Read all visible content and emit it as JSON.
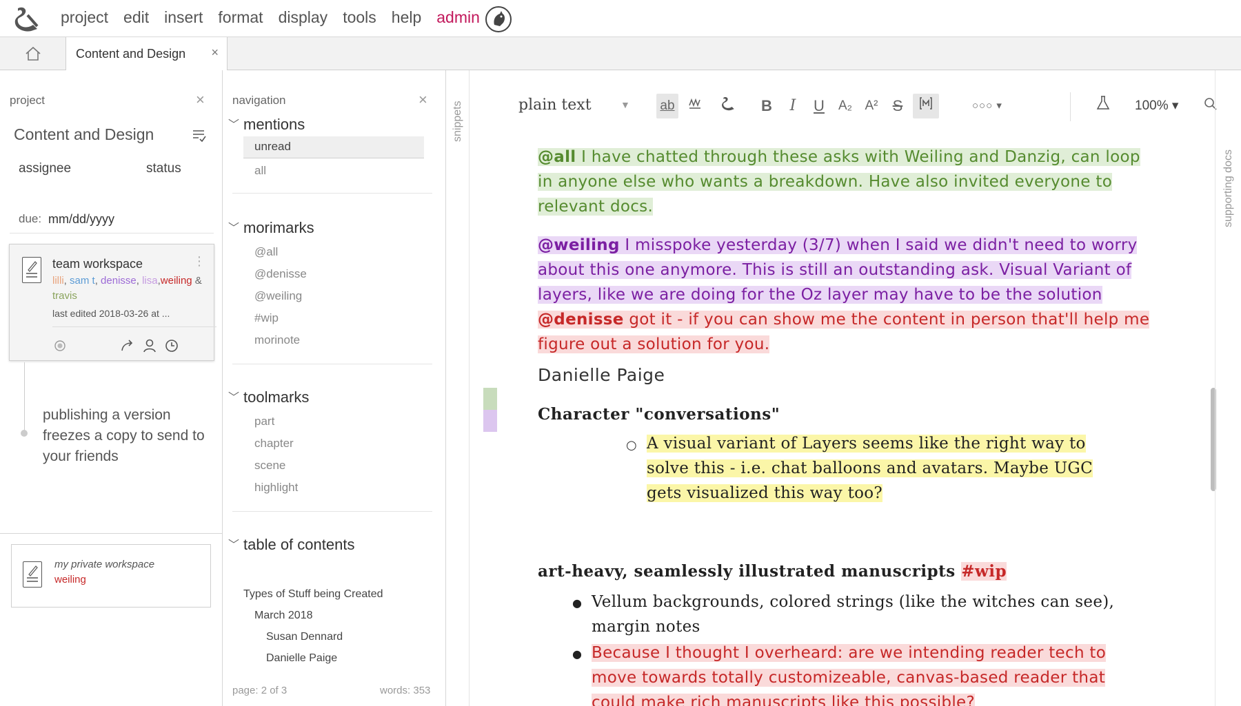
{
  "menu": {
    "items": [
      "project",
      "edit",
      "insert",
      "format",
      "display",
      "tools",
      "help"
    ],
    "admin": "admin"
  },
  "tabs": {
    "doc_tab": "Content and Design",
    "close": "×"
  },
  "project_panel": {
    "header": "project",
    "close": "×",
    "title": "Content and Design",
    "assignee_label": "assignee",
    "status_label": "status",
    "due_label": "due:",
    "due_value": "mm/dd/yyyy",
    "card": {
      "title": "team workspace",
      "members": [
        {
          "name": "lilli",
          "color": "#e8a37c",
          "sep": ", "
        },
        {
          "name": "sam t",
          "color": "#5b9bd5",
          "sep": ", "
        },
        {
          "name": "denisse",
          "color": "#9c6ad6",
          "sep": ", "
        },
        {
          "name": "lisa",
          "color": "#c59be0",
          "sep": ","
        },
        {
          "name": "weiling",
          "color": "#c62828",
          "sep": " & "
        },
        {
          "name": "travis",
          "color": "#8aa35c",
          "sep": ""
        }
      ],
      "edited": "last edited 2018-03-26 at ..."
    },
    "publish_note": "publishing a version freezes a copy to send to your friends",
    "private_card": {
      "title": "my private workspace",
      "user": "weiling"
    }
  },
  "navigation": {
    "header": "navigation",
    "close": "×",
    "mentions": {
      "label": "mentions",
      "items": [
        "unread",
        "all"
      ]
    },
    "morimarks": {
      "label": "morimarks",
      "items": [
        "@all",
        "@denisse",
        "@weiling",
        "#wip",
        "morinote"
      ]
    },
    "toolmarks": {
      "label": "toolmarks",
      "items": [
        "part",
        "chapter",
        "scene",
        "highlight"
      ]
    },
    "toc": {
      "label": "table of contents",
      "items": [
        "Types of Stuff being Created",
        "March 2018",
        "Susan Dennard",
        "Danielle Paige"
      ]
    },
    "page": "page: 2 of 3",
    "words": "words: 353"
  },
  "sidebar_labels": {
    "snippets": "snippets",
    "supporting_docs": "supporting docs"
  },
  "toolbar": {
    "style": "plain text",
    "ab": "ab",
    "bold": "B",
    "italic": "I",
    "underline": "U",
    "subscript": "A₂",
    "superscript": "A²",
    "strike": "S",
    "more": "○○○ ▾",
    "zoom": "100% ▾"
  },
  "editor": {
    "p1_mention": "@all",
    "p1_text": " I have chatted through these asks with Weiling and Danzig, can loop in anyone else who wants a breakdown. Have also invited everyone to relevant docs.",
    "p2_mention": "@weiling",
    "p2_text": " I misspoke yesterday (3/7) when I said we didn't need to worry about this one anymore. This is still an outstanding ask. Visual Variant of layers, like we are doing for the Oz layer may have to be the solution",
    "p3_mention": "@denisse",
    "p3_text": " got it - if you can show me the content in person that'll help me figure out a solution for you.",
    "author": "Danielle Paige",
    "heading1": "Character \"conversations\"",
    "bullet1": "A visual variant of Layers seems like the right way to solve this - i.e. chat balloons and avatars. Maybe UGC gets visualized this way too?",
    "heading2": "art-heavy, seamlessly illustrated manuscripts ",
    "heading2_tag": "#wip",
    "bullet2": "Vellum backgrounds, colored strings (like the witches can see), margin notes",
    "bullet3": "Because I thought I overheard: are we intending reader tech to move towards totally customizeable, canvas-based reader that could make rich manuscripts like this possible?"
  },
  "colors": {
    "accent": "#c2185b",
    "green_mark": "#c8dcbc",
    "purple_mark": "#dcc6ef"
  }
}
